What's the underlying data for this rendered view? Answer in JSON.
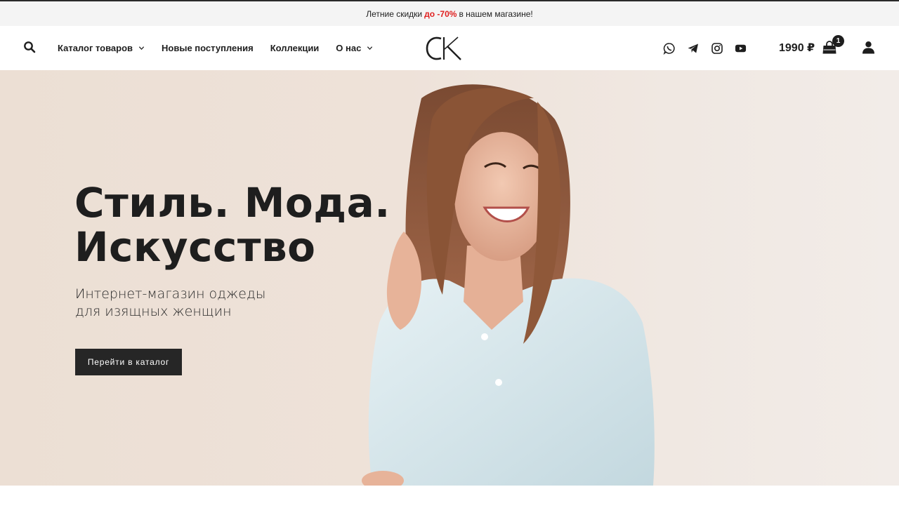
{
  "promo": {
    "text_before": "Летние скидки",
    "accent": "до -70%",
    "text_after": "в нашем магазине!",
    "accent_color": "#e02020"
  },
  "header": {
    "search_icon": "search-icon",
    "nav": [
      {
        "label": "Каталог товаров",
        "has_dropdown": true
      },
      {
        "label": "Новые поступления",
        "has_dropdown": false
      },
      {
        "label": "Коллекции",
        "has_dropdown": false
      },
      {
        "label": "О нас",
        "has_dropdown": true
      }
    ],
    "logo_text": "CK",
    "social_icons": [
      "whatsapp-icon",
      "telegram-icon",
      "instagram-icon",
      "youtube-icon"
    ],
    "cart_total": "1990 ₽",
    "cart_count": "1",
    "user_icon": "user-icon"
  },
  "hero": {
    "title_line1": "Стиль. Мода.",
    "title_line2": "Искусство",
    "subtitle_line1": "Интернет-магазин оджеды",
    "subtitle_line2": "для изящных женщин",
    "cta_label": "Перейти в каталог",
    "background_color": "#eee2d9",
    "button_color": "#262626"
  }
}
